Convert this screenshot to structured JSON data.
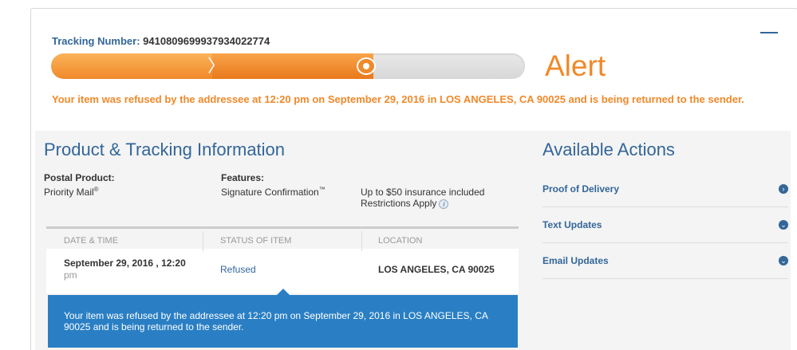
{
  "tracking": {
    "label": "Tracking Number:",
    "number": "9410809699937934022774"
  },
  "status": {
    "title": "Alert",
    "progress": 0.68,
    "message": "Your item was refused by the addressee at 12:20 pm on September 29, 2016 in LOS ANGELES, CA 90025 and is being returned to the sender."
  },
  "product": {
    "section_title": "Product & Tracking Information",
    "postal_product_label": "Postal Product:",
    "postal_product_value": "Priority Mail",
    "postal_product_mark": "®",
    "features_label": "Features:",
    "feature_1": "Signature Confirmation",
    "feature_1_mark": "™",
    "feature_2_line1": "Up to $50 insurance included",
    "feature_2_line2": "Restrictions Apply",
    "info_icon": "i"
  },
  "table": {
    "headers": [
      "DATE & TIME",
      "STATUS OF ITEM",
      "LOCATION"
    ],
    "row": {
      "date": "September 29, 2016 , 12:20",
      "date_suffix": "pm",
      "status": "Refused",
      "location": "LOS ANGELES, CA 90025"
    },
    "detail": "Your item was refused by the addressee at 12:20 pm on September 29, 2016 in LOS ANGELES, CA 90025 and is being returned to the sender."
  },
  "actions": {
    "title": "Available Actions",
    "items": [
      {
        "label": "Proof of Delivery",
        "icon": "chevron-right-icon",
        "glyph": "›"
      },
      {
        "label": "Text Updates",
        "icon": "chevron-down-icon",
        "glyph": "⌄"
      },
      {
        "label": "Email Updates",
        "icon": "chevron-down-icon",
        "glyph": "⌄"
      }
    ]
  },
  "colors": {
    "orange": "#f0892a",
    "blue": "#336699",
    "tooltip": "#2a7fc4"
  }
}
